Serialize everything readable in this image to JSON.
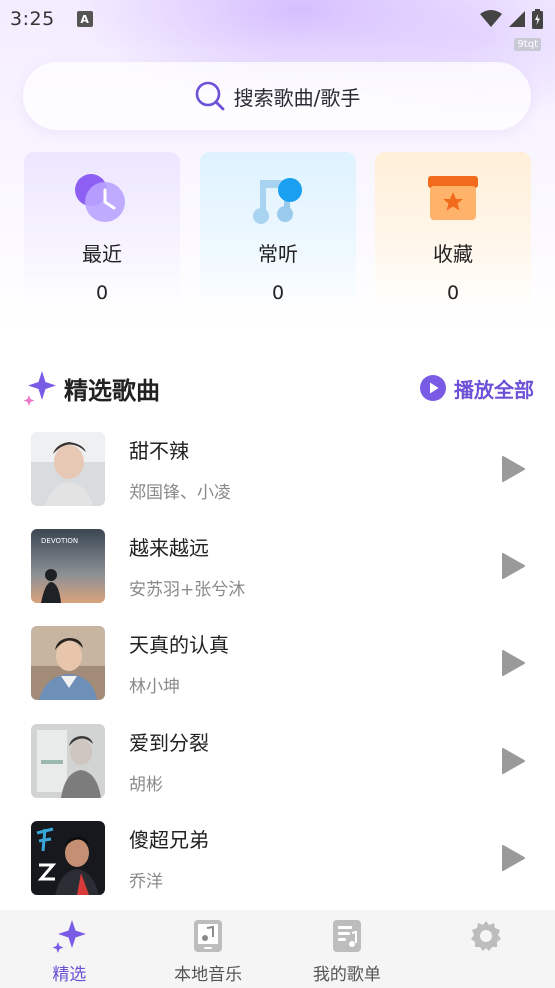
{
  "status_bar": {
    "time": "3:25",
    "badge": "A",
    "tag": "9tqt"
  },
  "search": {
    "placeholder": "搜索歌曲/歌手"
  },
  "quick_cards": [
    {
      "label": "最近",
      "count": "0",
      "icon": "clock-icon"
    },
    {
      "label": "常听",
      "count": "0",
      "icon": "music-note-icon"
    },
    {
      "label": "收藏",
      "count": "0",
      "icon": "star-box-icon"
    }
  ],
  "featured": {
    "title": "精选歌曲",
    "play_all_label": "播放全部",
    "songs": [
      {
        "title": "甜不辣",
        "artist": "郑国锋、小凌"
      },
      {
        "title": "越来越远",
        "artist": "安苏羽+张兮沐",
        "cover_text": "DEVOTION"
      },
      {
        "title": "天真的认真",
        "artist": "林小坤"
      },
      {
        "title": "爱到分裂",
        "artist": "胡彬"
      },
      {
        "title": "傻超兄弟",
        "artist": "乔洋"
      }
    ]
  },
  "tabbar": [
    {
      "label": "精选",
      "icon": "sparkle-icon",
      "active": true
    },
    {
      "label": "本地音乐",
      "icon": "phone-music-icon",
      "active": false
    },
    {
      "label": "我的歌单",
      "icon": "playlist-icon",
      "active": false
    },
    {
      "label": "",
      "icon": "gear-icon",
      "active": false
    }
  ],
  "colors": {
    "accent": "#6d52d8",
    "text": "#222222",
    "subtext": "#8a8a8a"
  }
}
